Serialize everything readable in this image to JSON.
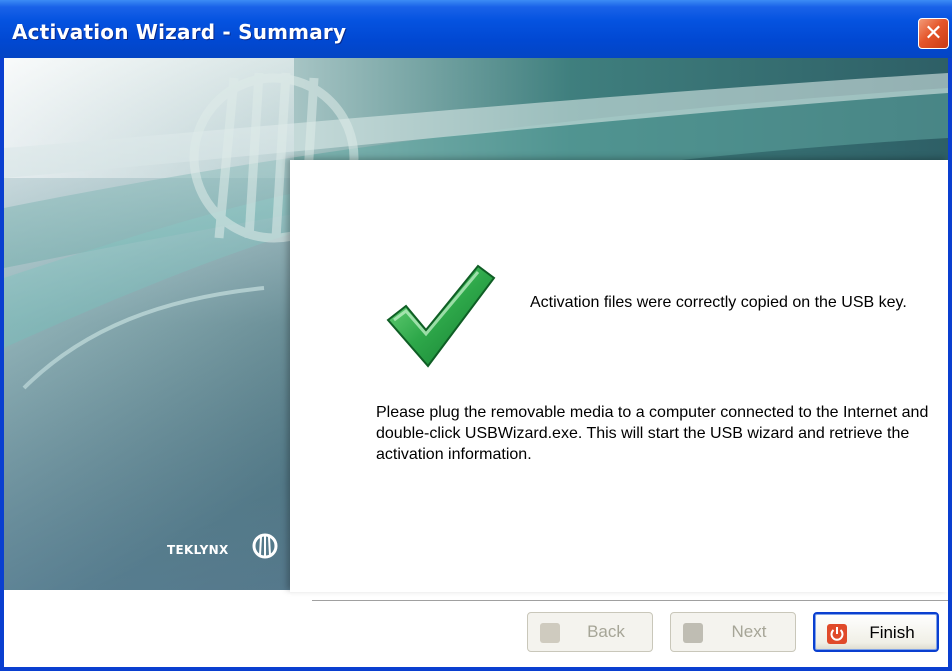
{
  "window": {
    "title": "Activation Wizard - Summary",
    "close_glyph": "✕"
  },
  "sidebar": {
    "logo_text": "TEKLYNX"
  },
  "content": {
    "success_message": "Activation files were correctly copied on the USB key.",
    "instructions": "Please plug the removable media to a computer connected to the Internet and double-click USBWizard.exe. This will start the USB wizard and retrieve the activation information."
  },
  "buttons": {
    "back_label": "Back",
    "next_label": "Next",
    "finish_label": "Finish"
  },
  "icons": {
    "success": "checkmark-icon",
    "back": "back-arrow-icon",
    "next": "next-arrow-icon",
    "finish": "power-icon"
  },
  "colors": {
    "titlebar": "#0553e0",
    "close_button": "#e5562b",
    "checkmark": "#2ea84a",
    "banner_teal": "#3f8a86"
  },
  "state": {
    "back_enabled": false,
    "next_enabled": false,
    "finish_enabled": true
  }
}
